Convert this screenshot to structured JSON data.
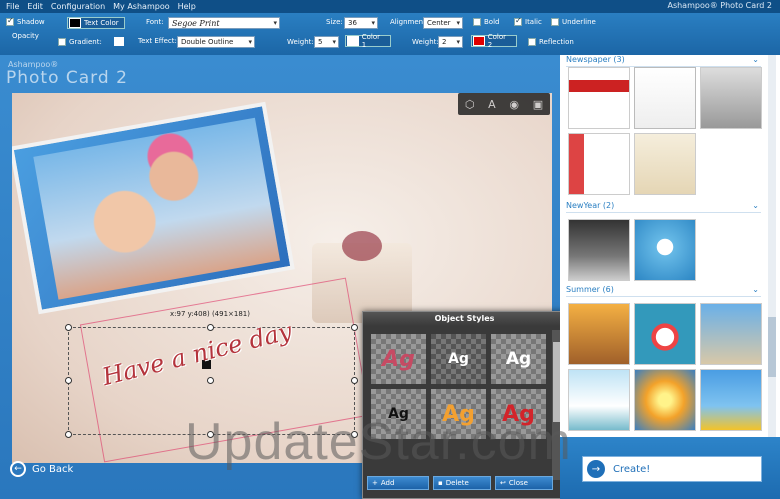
{
  "app": {
    "brand_line": "Ashampoo® Photo Card 2",
    "logo_small": "Ashampoo®",
    "logo_big": "Photo Card 2"
  },
  "menu": [
    "File",
    "Edit",
    "Configuration",
    "My Ashampoo",
    "Help"
  ],
  "toolbar": {
    "shadow_label": "Shadow",
    "opacity_label": "Opacity",
    "gradient_label": "Gradient:",
    "text_color_label": "Text Color",
    "text_color": "#000000",
    "font_label": "Font:",
    "font_value": "Segoe Print",
    "text_effect_label": "Text Effect:",
    "text_effect_value": "Double Outline",
    "size_label": "Size:",
    "size_value": "36",
    "weight_label": "Weight:",
    "weight1_value": "5",
    "color1_label": "Color 1",
    "color1": "#ffffff",
    "alignment_label": "Alignment:",
    "alignment_value": "Center",
    "weight2_label": "Weight:",
    "weight2_value": "2",
    "color2_label": "Color 2",
    "color2": "#e00000",
    "bold_label": "Bold",
    "italic_label": "Italic",
    "underline_label": "Underline",
    "reflection_label": "Reflection"
  },
  "canvas": {
    "coords_text": "x:97 y:408) (491×181)",
    "card_text": "Have a nice day"
  },
  "object_styles": {
    "title": "Object Styles",
    "tile_text": "Ag",
    "add_label": "Add",
    "delete_label": "Delete",
    "close_label": "Close"
  },
  "go_back_label": "Go Back",
  "categories": [
    {
      "label": "Newspaper (3)"
    },
    {
      "label": "NewYear (2)"
    },
    {
      "label": "Summer (6)"
    }
  ],
  "create_label": "Create!",
  "watermark": "UpdateStar.com"
}
